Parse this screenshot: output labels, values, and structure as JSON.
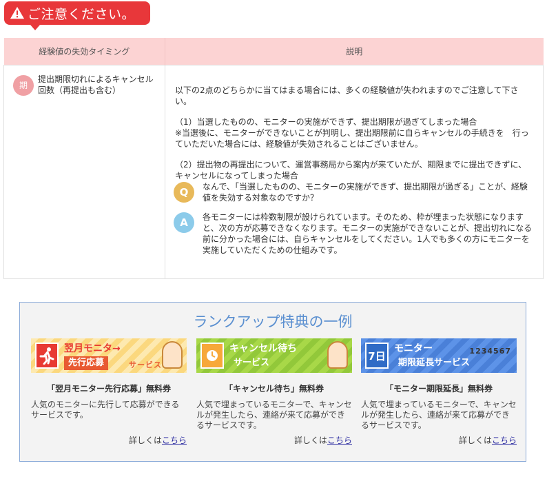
{
  "warning": {
    "title": "ご注意ください。",
    "icon": "warning-icon"
  },
  "table": {
    "headers": [
      "経験値の失効タイミング",
      "説明"
    ],
    "row": {
      "badge": "期",
      "timing": "提出期限切れによるキャンセル回数（再提出も含む）",
      "intro": "以下の2点のどちらかに当てはまる場合には、多くの経験値が失われますのでご注意して下さい。",
      "case1_title": "（1）当選したものの、モニターの実施ができず、提出期限が過ぎてしまった場合",
      "case1_note": "※当選後に、モニターができないことが判明し、提出期限前に自らキャンセルの手続きを　行っていただいた場合には、経験値が失効されることはございません。",
      "case2_title": "（2）提出物の再提出について、運営事務局から案内が来ていたが、期限までに提出できずに、キャンセルになってしまった場合",
      "q_label": "Q",
      "question": "なんで、「当選したものの、モニターの実施ができず、提出期限が過ぎる」ことが、経験値を失効する対象なのですか？",
      "a_label": "A",
      "answer": "各モニターには枠数制限が設けられています。そのため、枠が埋まった状態になりますと、次の方が応募できなくなります。モニターの実施ができないことが、提出切れになる前に分かった場合には、自らキャンセルをしてください。1人でも多くの方にモニターを実施していただくための仕組みです。"
    }
  },
  "rank": {
    "title": "ランクアップ特典の一例",
    "more_prefix": "詳しくは",
    "more_link": "こちら",
    "cards": [
      {
        "banner_line1": "翌月モニタ→",
        "banner_line2": "先行応募",
        "banner_extra": "サービス",
        "name": "「翌月モニター先行応募」無料券",
        "desc": "人気のモニターに先行して応募ができるサービスです。"
      },
      {
        "banner_line1": "キャンセル待ち",
        "banner_line2": "サービス",
        "banner_extra": "",
        "name": "「キャンセル待ち」無料券",
        "desc": "人気で埋まっているモニターで、キャンセルが発生したら、連絡が来て応募ができるサービスです。"
      },
      {
        "banner_icon": "7日",
        "banner_line1": "モニター",
        "banner_line2": "期限延長サービス",
        "banner_extra": "1234567",
        "name": "「モニター期限延長」無料券",
        "desc": "人気で埋まっているモニターで、キャンセルが発生したら、連絡が来て応募ができるサービスです。"
      }
    ]
  },
  "colors": {
    "warning_red": "#e8373a",
    "header_pink": "#fcd3d3",
    "rank_blue": "#5a8fd0"
  }
}
